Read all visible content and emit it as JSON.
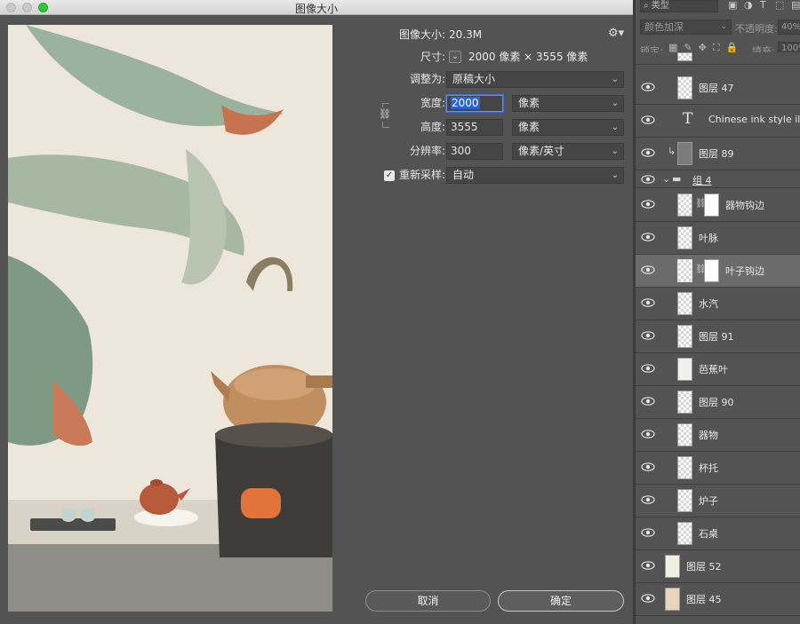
{
  "dialog": {
    "title": "图像大小",
    "image_size_label": "图像大小:",
    "image_size_value": "20.3M",
    "dimensions_label": "尺寸:",
    "dimensions_value": "2000 像素  ×  3555 像素",
    "fit_to_label": "调整为:",
    "fit_to_value": "原稿大小",
    "width_label": "宽度:",
    "width_value": "2000",
    "width_unit": "像素",
    "height_label": "高度:",
    "height_value": "3555",
    "height_unit": "像素",
    "resolution_label": "分辨率:",
    "resolution_value": "300",
    "resolution_unit": "像素/英寸",
    "resample_checked": true,
    "resample_label": "重新采样:",
    "resample_value": "自动",
    "cancel_label": "取消",
    "ok_label": "确定"
  },
  "layers_panel": {
    "filter_placeholder": "类型",
    "blend_mode": "颜色加深",
    "opacity_label": "不透明度:",
    "opacity_value": "40%",
    "lock_label": "锁定:",
    "fill_label": "填充:",
    "fill_value": "100%",
    "layers": [
      {
        "name": "图层 47",
        "type": "pixel"
      },
      {
        "name": "Chinese ink style illust",
        "type": "text"
      },
      {
        "name": "图层 89",
        "type": "pixel",
        "clipped": true
      },
      {
        "name": "组 4",
        "type": "group"
      },
      {
        "name": "器物钩边",
        "type": "masked"
      },
      {
        "name": "叶脉",
        "type": "pixel"
      },
      {
        "name": "叶子钩边",
        "type": "masked",
        "selected": true
      },
      {
        "name": "水汽",
        "type": "pixel"
      },
      {
        "name": "图层 91",
        "type": "pixel"
      },
      {
        "name": "芭蕉叶",
        "type": "pixel"
      },
      {
        "name": "图层 90",
        "type": "pixel"
      },
      {
        "name": "器物",
        "type": "pixel"
      },
      {
        "name": "杯托",
        "type": "pixel"
      },
      {
        "name": "炉子",
        "type": "pixel"
      },
      {
        "name": "石桌",
        "type": "pixel"
      },
      {
        "name": "图层 52",
        "type": "pixel"
      },
      {
        "name": "图层 45",
        "type": "pixel"
      }
    ]
  },
  "colors": {
    "accent": "#2a62d3",
    "panel_bg": "#535353",
    "zoom_button": "#2fc63f"
  }
}
